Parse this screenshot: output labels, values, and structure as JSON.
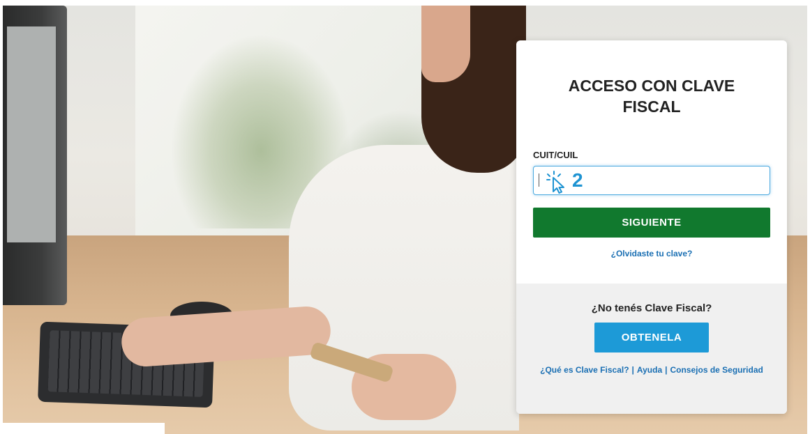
{
  "login": {
    "title": "ACCESO CON CLAVE FISCAL",
    "cuit_label": "CUIT/CUIL",
    "cuit_value": "",
    "step_number": "2",
    "next_button": "SIGUIENTE",
    "forgot_link": "¿Olvidaste tu clave?"
  },
  "footer": {
    "no_clave": "¿No tenés Clave Fiscal?",
    "get_button": "OBTENELA",
    "links": {
      "what_is": "¿Qué es Clave Fiscal?",
      "help": "Ayuda",
      "security": "Consejos de Seguridad",
      "separator": "|"
    }
  },
  "colors": {
    "primary_green": "#11792e",
    "primary_blue": "#1d9ad7",
    "link_blue": "#1a6fb3",
    "focus_blue": "#4aa8df",
    "annotation_blue": "#1e93d2"
  },
  "icons": {
    "cursor": "click-cursor-icon"
  }
}
